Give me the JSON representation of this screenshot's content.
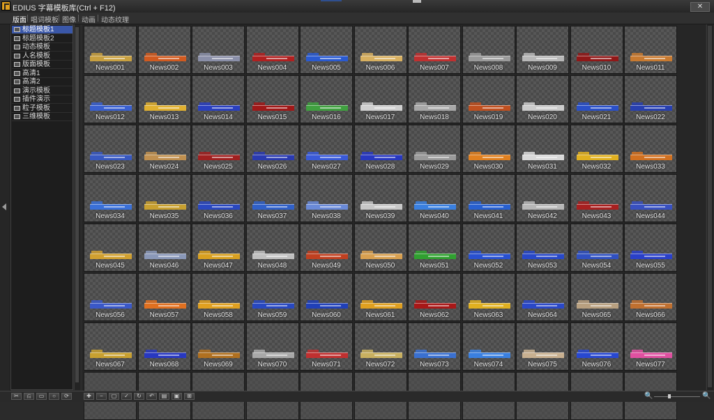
{
  "window": {
    "title": "EDIUS 字幕模板库(Ctrl + F12)",
    "close_label": "✕"
  },
  "tabs": [
    {
      "label": "版面",
      "active": true
    },
    {
      "label": "唱词模板",
      "active": false
    },
    {
      "label": "图像",
      "active": false
    },
    {
      "label": "动画",
      "active": false
    },
    {
      "label": "动态纹理",
      "active": false
    }
  ],
  "tree": {
    "selected": "标题模板1",
    "items": [
      "标题模板1",
      "标题模板2",
      "动态模板",
      "人名模板",
      "版面模板",
      "高清1",
      "高清2",
      "演示模板",
      "插件演示",
      "粒子模板",
      "三维模板"
    ]
  },
  "grid": {
    "columns": 11,
    "total_slots": 88,
    "items": [
      {
        "label": "News001",
        "color": "#c8a040"
      },
      {
        "label": "News002",
        "color": "#d05a20"
      },
      {
        "label": "News003",
        "color": "#8a8fa8"
      },
      {
        "label": "News004",
        "color": "#b02020"
      },
      {
        "label": "News005",
        "color": "#2a5ad0"
      },
      {
        "label": "News006",
        "color": "#d8b060"
      },
      {
        "label": "News007",
        "color": "#c03030"
      },
      {
        "label": "News008",
        "color": "#9a9a9a"
      },
      {
        "label": "News009",
        "color": "#b8b8b8"
      },
      {
        "label": "News010",
        "color": "#901818"
      },
      {
        "label": "News011",
        "color": "#c87a30"
      },
      {
        "label": "News012",
        "color": "#3a60d0"
      },
      {
        "label": "News013",
        "color": "#e0b030"
      },
      {
        "label": "News014",
        "color": "#2a40c0"
      },
      {
        "label": "News015",
        "color": "#a01818"
      },
      {
        "label": "News016",
        "color": "#40a040"
      },
      {
        "label": "News017",
        "color": "#d0d0d0"
      },
      {
        "label": "News018",
        "color": "#a8a8a8"
      },
      {
        "label": "News019",
        "color": "#c05020"
      },
      {
        "label": "News020",
        "color": "#cccccc"
      },
      {
        "label": "News021",
        "color": "#2a50c8"
      },
      {
        "label": "News022",
        "color": "#2840b0"
      },
      {
        "label": "News023",
        "color": "#3858c0"
      },
      {
        "label": "News024",
        "color": "#c09050"
      },
      {
        "label": "News025",
        "color": "#a02020"
      },
      {
        "label": "News026",
        "color": "#2a3ab0"
      },
      {
        "label": "News027",
        "color": "#3a5ad8"
      },
      {
        "label": "News028",
        "color": "#2838c0"
      },
      {
        "label": "News029",
        "color": "#9a9a9a"
      },
      {
        "label": "News030",
        "color": "#e08020"
      },
      {
        "label": "News031",
        "color": "#d8d8d8"
      },
      {
        "label": "News032",
        "color": "#e0b020"
      },
      {
        "label": "News033",
        "color": "#d07020"
      },
      {
        "label": "News034",
        "color": "#3a70d8"
      },
      {
        "label": "News035",
        "color": "#c8a030"
      },
      {
        "label": "News036",
        "color": "#2a48c0"
      },
      {
        "label": "News037",
        "color": "#3060c8"
      },
      {
        "label": "News038",
        "color": "#6a8ad8"
      },
      {
        "label": "News039",
        "color": "#c8c8c8"
      },
      {
        "label": "News040",
        "color": "#3a80e0"
      },
      {
        "label": "News041",
        "color": "#2860d0"
      },
      {
        "label": "News042",
        "color": "#b8b8b8"
      },
      {
        "label": "News043",
        "color": "#a82020"
      },
      {
        "label": "News044",
        "color": "#3850c0"
      },
      {
        "label": "News045",
        "color": "#d0a030"
      },
      {
        "label": "News046",
        "color": "#8a98b8"
      },
      {
        "label": "News047",
        "color": "#d8a020"
      },
      {
        "label": "News048",
        "color": "#c0c0c0"
      },
      {
        "label": "News049",
        "color": "#c04020"
      },
      {
        "label": "News050",
        "color": "#d8a050"
      },
      {
        "label": "News051",
        "color": "#30a030"
      },
      {
        "label": "News052",
        "color": "#2850d0"
      },
      {
        "label": "News053",
        "color": "#2848c8"
      },
      {
        "label": "News054",
        "color": "#3050c0"
      },
      {
        "label": "News055",
        "color": "#2a40c8"
      },
      {
        "label": "News056",
        "color": "#3a58c8"
      },
      {
        "label": "News057",
        "color": "#e07020"
      },
      {
        "label": "News058",
        "color": "#e0a020"
      },
      {
        "label": "News059",
        "color": "#2848c0"
      },
      {
        "label": "News060",
        "color": "#2040b8"
      },
      {
        "label": "News061",
        "color": "#e0a020"
      },
      {
        "label": "News062",
        "color": "#a81818"
      },
      {
        "label": "News063",
        "color": "#e0b020"
      },
      {
        "label": "News064",
        "color": "#2a48c8"
      },
      {
        "label": "News065",
        "color": "#b8a080"
      },
      {
        "label": "News066",
        "color": "#c07030"
      },
      {
        "label": "News067",
        "color": "#c8a030"
      },
      {
        "label": "News068",
        "color": "#2838c0"
      },
      {
        "label": "News069",
        "color": "#b07020"
      },
      {
        "label": "News070",
        "color": "#a8a8a8"
      },
      {
        "label": "News071",
        "color": "#c03030"
      },
      {
        "label": "News072",
        "color": "#c8b060"
      },
      {
        "label": "News073",
        "color": "#3a70d0"
      },
      {
        "label": "News074",
        "color": "#3a80e0"
      },
      {
        "label": "News075",
        "color": "#c8b090"
      },
      {
        "label": "News076",
        "color": "#2848d0"
      },
      {
        "label": "News077",
        "color": "#e050a0"
      }
    ]
  },
  "toolbar": {
    "left_buttons": [
      "✂",
      "⎌",
      "▭",
      "○",
      "⟳"
    ],
    "right_buttons": [
      "✚",
      "−",
      "▢",
      "✓",
      "↻",
      "↶",
      "▤",
      "▣",
      "⊞"
    ]
  },
  "zoom": {
    "out_icon": "🔍",
    "in_icon": "🔍",
    "level": 0.3
  }
}
